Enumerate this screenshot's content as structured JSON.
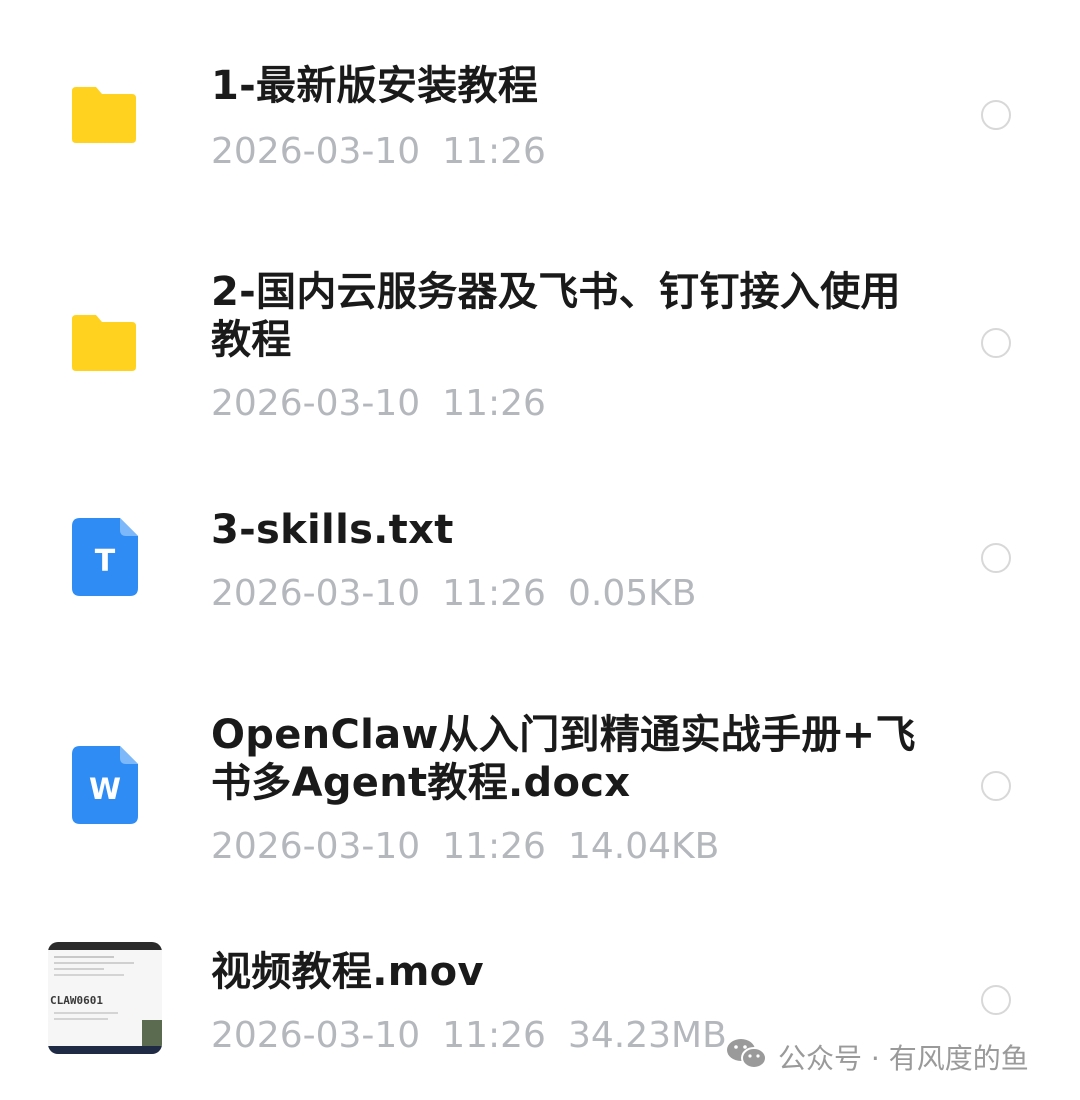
{
  "files": [
    {
      "name": "1-最新版安装教程",
      "date": "2026-03-10",
      "time": "11:26",
      "size": "",
      "icon": "folder-icon"
    },
    {
      "name": "2-国内云服务器及飞书、钉钉接入使用教程",
      "date": "2026-03-10",
      "time": "11:26",
      "size": "",
      "icon": "folder-icon"
    },
    {
      "name": "3-skills.txt",
      "date": "2026-03-10",
      "time": "11:26",
      "size": "0.05KB",
      "icon": "txt-file-icon",
      "icon_letter": "T"
    },
    {
      "name": "OpenClaw从入门到精通实战手册+飞书多Agent教程.docx",
      "date": "2026-03-10",
      "time": "11:26",
      "size": "14.04KB",
      "icon": "word-file-icon",
      "icon_letter": "W"
    },
    {
      "name": "视频教程.mov",
      "date": "2026-03-10",
      "time": "11:26",
      "size": "34.23MB",
      "icon": "video-thumbnail",
      "thumb_text": "CLAW0601"
    }
  ],
  "colors": {
    "folder": "#FFD21F",
    "file_blue": "#2F8CF5",
    "meta": "#B4B7BC",
    "radio_border": "#D8D8D8"
  },
  "watermark": {
    "text": "公众号 · 有风度的鱼",
    "icon": "wechat-icon"
  }
}
